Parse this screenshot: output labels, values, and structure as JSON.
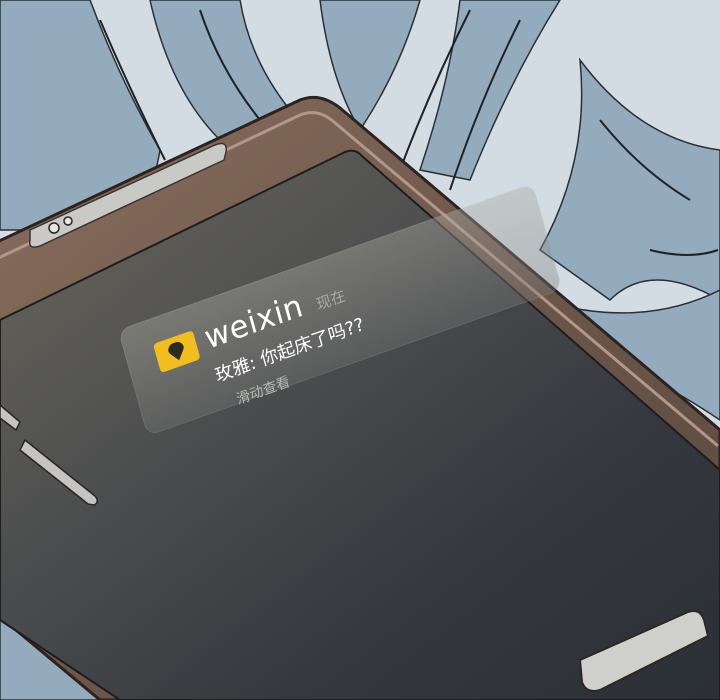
{
  "notification": {
    "app_name": "weixin",
    "time": "现在",
    "message": "玫雅: 你起床了吗??",
    "hint": "滑动查看",
    "icon": "weixin-app-icon"
  },
  "colors": {
    "background": "#cfd8df",
    "sleeve_shadow": "#93aabd",
    "phone_frame": "#70584b",
    "screen": "#34373c",
    "icon_yellow": "#f1bd1f"
  }
}
